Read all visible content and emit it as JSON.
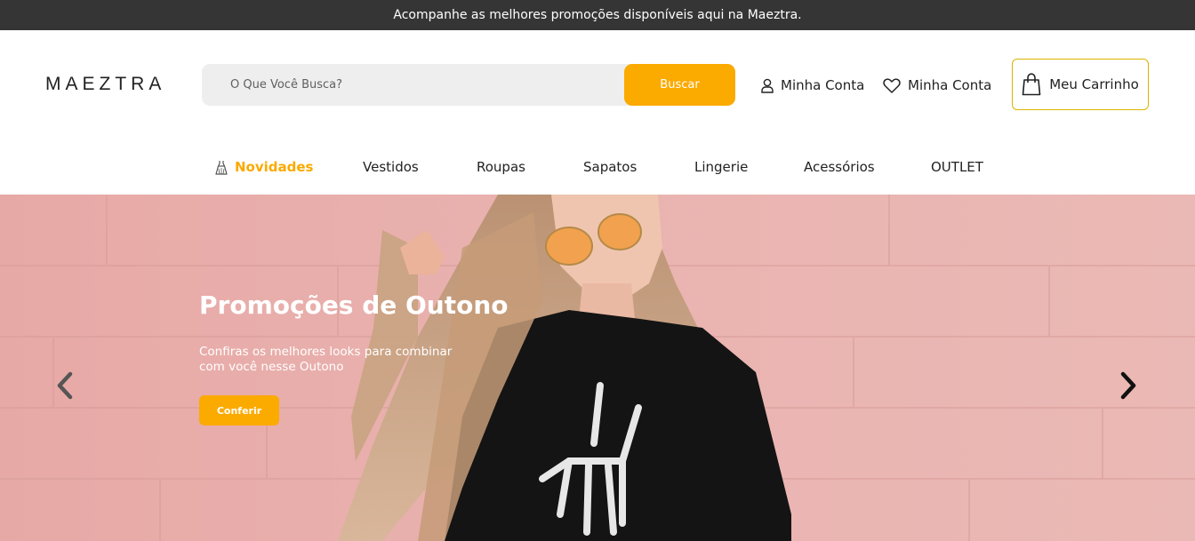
{
  "announcement": {
    "text": "Acompanhe as melhores promoções disponíveis aqui na Maeztra."
  },
  "header": {
    "logo_text": "MAEZTRA",
    "search": {
      "placeholder": "O Que Você Busca?",
      "value": "",
      "button_label": "Buscar"
    },
    "account_label": "Minha Conta",
    "wishlist_label": "Minha Conta",
    "cart_label": "Meu Carrinho",
    "icons": {
      "account": "user-icon",
      "wishlist": "heart-icon",
      "cart": "shopping-bag-icon"
    }
  },
  "nav": {
    "items": [
      {
        "label": "Novidades",
        "active": true,
        "icon": "dress-icon"
      },
      {
        "label": "Vestidos",
        "active": false
      },
      {
        "label": "Roupas",
        "active": false
      },
      {
        "label": "Sapatos",
        "active": false
      },
      {
        "label": "Lingerie",
        "active": false
      },
      {
        "label": "Acessórios",
        "active": false
      },
      {
        "label": "OUTLET",
        "active": false
      }
    ]
  },
  "hero": {
    "title": "Promoções de Outono",
    "text": "Confiras os melhores looks para combinar com você nesse Outono",
    "cta_label": "Conferir",
    "prev_icon": "chevron-left-icon",
    "next_icon": "chevron-right-icon"
  },
  "colors": {
    "accent": "#fbaa00",
    "topbar": "#353535",
    "hero_bg": "#e7b0ad"
  }
}
